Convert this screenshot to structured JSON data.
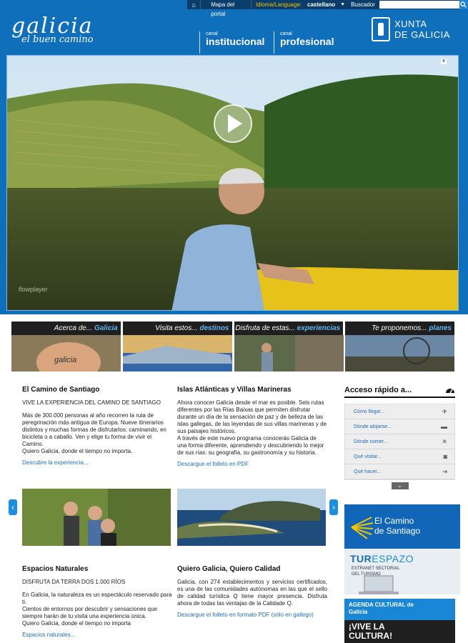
{
  "topbar": {
    "home_icon": "home-icon",
    "map_link": "Mapa del portal",
    "lang_label": "Idioma/Language:",
    "lang_value": "castellano",
    "search_label": "Buscador",
    "search_placeholder": ""
  },
  "header": {
    "logo_word": "galicia",
    "logo_tag": "el buen camino",
    "canal1_small": "canal",
    "canal1_big": "institucional",
    "canal2_small": "canal",
    "canal2_big": "profesional",
    "xunta_line1": "XUNTA",
    "xunta_line2": "DE GALICIA"
  },
  "video": {
    "close": "x",
    "flowplayer": "flowplayer"
  },
  "categories": [
    {
      "pre": "Acerca de...",
      "hl": "Galicia"
    },
    {
      "pre": "Visita estos...",
      "hl": "destinos"
    },
    {
      "pre": "Disfruta de estas...",
      "hl": "experiencias"
    },
    {
      "pre": "Te proponemos...",
      "hl": "planes"
    }
  ],
  "articles": {
    "camino": {
      "title": "El Camino de Santiago",
      "sub": "VIVE LA EXPERIENCIA DEL CAMINO DE SANTIAGO",
      "body": "Más de 300.000 personas al año recorren la ruta de peregrinación más antigua de Europa. Nueve itinerarios distintos y muchas formas de disfrutarlos: caminando, en bicicleta o a caballo. Ven y elige tu forma de vivir el Camino.",
      "body2": "Quiero Galicia, donde el tiempo no importa.",
      "link": "Descubre la experiencia..."
    },
    "islas": {
      "title": "Islas Atlánticas y Villas Marineras",
      "body": "Ahora conocer Galicia desde el mar es posible. Seis rutas diferentes por las Rías Baixas que permiten disfrutar durante un día de la sensación de paz y de belleza de las islas gallegas, de las leyendas de sus villas marineras y de sus paisajes históricos.",
      "body2": "A través de este nuevo programa conocerás Galicia de una forma diferente, aprendiendo y descubriendo lo mejor de sus rías: su geografía, su gastronomía y su historia.",
      "link": "Descargue el folleto en PDF"
    },
    "espacios": {
      "title": "Espacios Naturales",
      "sub": "DISFRUTA DA TERRA DOS 1.000 RÍOS",
      "body": "En Galicia, la naturaleza es un espectáculo reservado para ti.",
      "body2": "Cientos de entornos por descubrir y sensaciones que siempre harán de tu visita una experiencia única.",
      "body3": "Quiero Galicia, donde el tiempo no importa",
      "link": "Espacios naturales..."
    },
    "calidad": {
      "title": "Quiero Galicia, Quiero Calidad",
      "body": "Galicia, con 274 establecimentos y servicios certificados, es una de las comunidades autónomas en las que el sello de calidad turística Q tiene mayor presencia. Disfruta ahora de todas las ventajas de la Calidade Q.",
      "link": "Descargue el folleto en formato PDF (sólo en gallego)"
    }
  },
  "acceso": {
    "title": "Acceso rápido a...",
    "items": [
      {
        "label": "Cómo llegar...",
        "icon": "plane-icon"
      },
      {
        "label": "Dónde alojarse...",
        "icon": "bed-icon"
      },
      {
        "label": "Dónde comer...",
        "icon": "cutlery-icon"
      },
      {
        "label": "Qué visitar...",
        "icon": "camera-icon"
      },
      {
        "label": "Qué hacer...",
        "icon": "signpost-icon"
      }
    ]
  },
  "banners": {
    "camino_line1": "El Camino",
    "camino_line2": "de Santiago",
    "tur_a": "TUR",
    "tur_b": "ESPAZO",
    "tur_sub1": "EXTRANET SECTORIAL",
    "tur_sub2": "DEL TURISMO",
    "agenda_line1": "AGENDA CULTURAL de",
    "agenda_line2": "Galicia",
    "cultura_line1": "¡VIVE LA",
    "cultura_line2": "CULTURA!"
  },
  "colors": {
    "header_blue": "#0f6fba",
    "link_blue": "#1f6eb8",
    "highlight_blue": "#5fb4f2"
  }
}
